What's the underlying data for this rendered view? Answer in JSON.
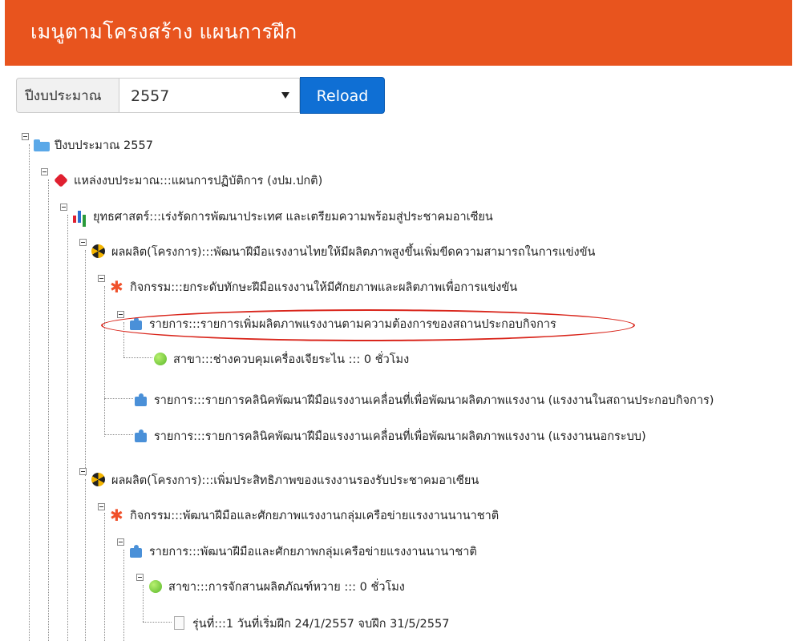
{
  "header": {
    "title": "เมนูตามโครงสร้าง แผนการฝึก"
  },
  "toolbar": {
    "budget_label": "ปีงบประมาณ",
    "year_value": "2557",
    "reload_label": "Reload"
  },
  "tree": {
    "n1": "ปีงบประมาณ 2557",
    "n2": "แหล่งงบประมาณ:::แผนการปฏิบัติการ (งปม.ปกติ)",
    "n3": "ยุทธศาสตร์:::เร่งรัดการพัฒนาประเทศ และเตรียมความพร้อมสู่ประชาคมอาเซียน",
    "n4": "ผลผลิต(โครงการ):::พัฒนาฝีมือแรงงานไทยให้มีผลิตภาพสูงขึ้นเพิ่มขีดความสามารถในการแข่งขัน",
    "n5": "กิจกรรม:::ยกระดับทักษะฝีมือแรงงานให้มีศักยภาพและผลิตภาพเพื่อการแข่งขัน",
    "n6": "รายการ:::รายการเพิ่มผลิตภาพแรงงานตามความต้องการของสถานประกอบกิจการ",
    "n7": "สาขา:::ช่างควบคุมเครื่องเจียระไน ::: 0 ชั่วโมง",
    "n8": "รายการ:::รายการคลินิคพัฒนาฝีมือแรงงานเคลื่อนที่เพื่อพัฒนาผลิตภาพแรงงาน (แรงงานในสถานประกอบกิจการ)",
    "n9": "รายการ:::รายการคลินิคพัฒนาฝีมือแรงงานเคลื่อนที่เพื่อพัฒนาผลิตภาพแรงงาน (แรงงานนอกระบบ)",
    "n10": "ผลผลิต(โครงการ):::เพิ่มประสิทธิภาพของแรงงานรองรับประชาคมอาเซียน",
    "n11": "กิจกรรม:::พัฒนาฝีมือและศักยภาพแรงงานกลุ่มเครือข่ายแรงงานนานาชาติ",
    "n12": "รายการ:::พัฒนาฝีมือและศักยภาพกลุ่มเครือข่ายแรงงานนานาชาติ",
    "n13": "สาขา:::การจักสานผลิตภัณฑ์หวาย ::: 0 ชั่วโมง",
    "n14": "รุ่นที่:::1 วันที่เริ่มฝึก 24/1/2557 จบฝึก 31/5/2557"
  }
}
